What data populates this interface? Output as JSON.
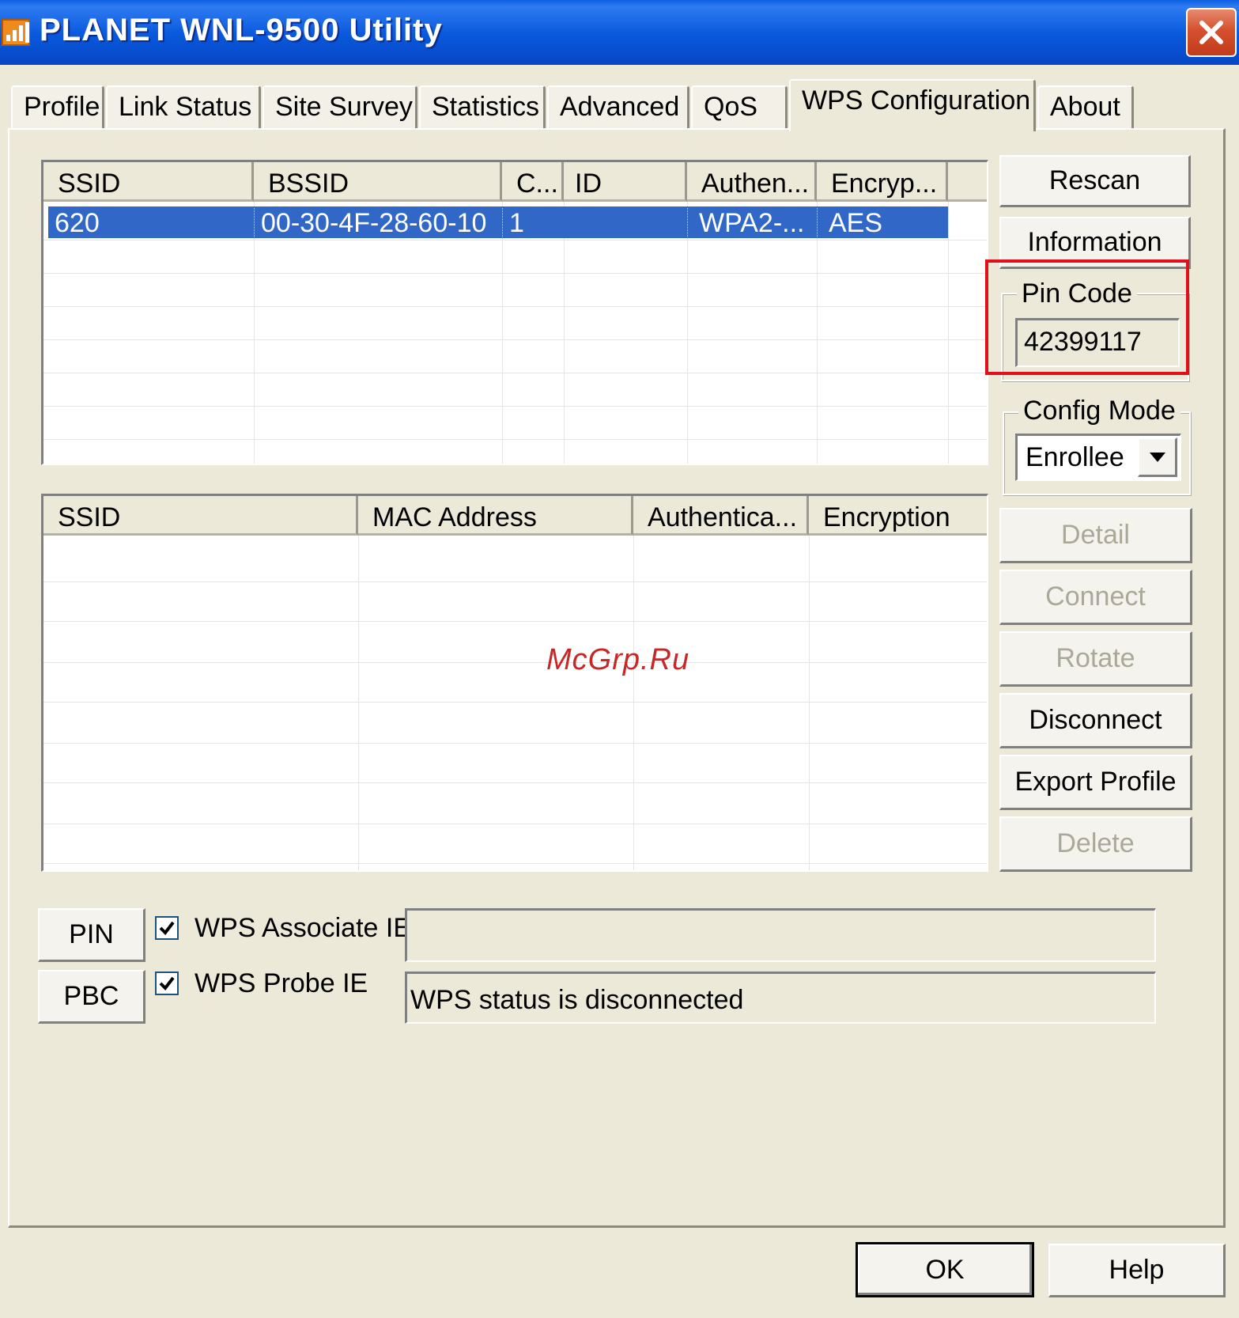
{
  "window": {
    "title": "PLANET WNL-9500 Utility"
  },
  "tabs": [
    {
      "label": "Profile"
    },
    {
      "label": "Link Status"
    },
    {
      "label": "Site Survey"
    },
    {
      "label": "Statistics"
    },
    {
      "label": "Advanced"
    },
    {
      "label": "QoS"
    },
    {
      "label": "WPS Configuration",
      "active": true
    },
    {
      "label": "About"
    }
  ],
  "ap_list": {
    "columns": [
      "SSID",
      "BSSID",
      "C...",
      "ID",
      "Authen...",
      "Encryp..."
    ],
    "rows": [
      {
        "ssid": "620",
        "bssid": "00-30-4F-28-60-10",
        "channel": "1",
        "id": "",
        "auth": "WPA2-...",
        "encryption": "AES",
        "selected": true
      }
    ]
  },
  "credentials_list": {
    "columns": [
      "SSID",
      "MAC Address",
      "Authentica...",
      "Encryption"
    ],
    "rows": []
  },
  "buttons": {
    "rescan": "Rescan",
    "information": "Information",
    "detail": "Detail",
    "connect": "Connect",
    "rotate": "Rotate",
    "disconnect": "Disconnect",
    "export_profile": "Export Profile",
    "delete": "Delete",
    "pin": "PIN",
    "pbc": "PBC",
    "ok": "OK",
    "help": "Help"
  },
  "pin_code": {
    "label": "Pin Code",
    "value": "42399117"
  },
  "config_mode": {
    "label": "Config Mode",
    "selected": "Enrollee"
  },
  "options": {
    "wps_associate_ie": {
      "label": "WPS Associate IE",
      "checked": true
    },
    "wps_probe_ie": {
      "label": "WPS Probe IE",
      "checked": true
    }
  },
  "status": {
    "associate_text": "",
    "message": "WPS status is disconnected"
  },
  "watermark": "McGrp.Ru",
  "colors": {
    "selection": "#3168c8",
    "highlight": "#e0101a",
    "titlebar": "#0858dc"
  }
}
